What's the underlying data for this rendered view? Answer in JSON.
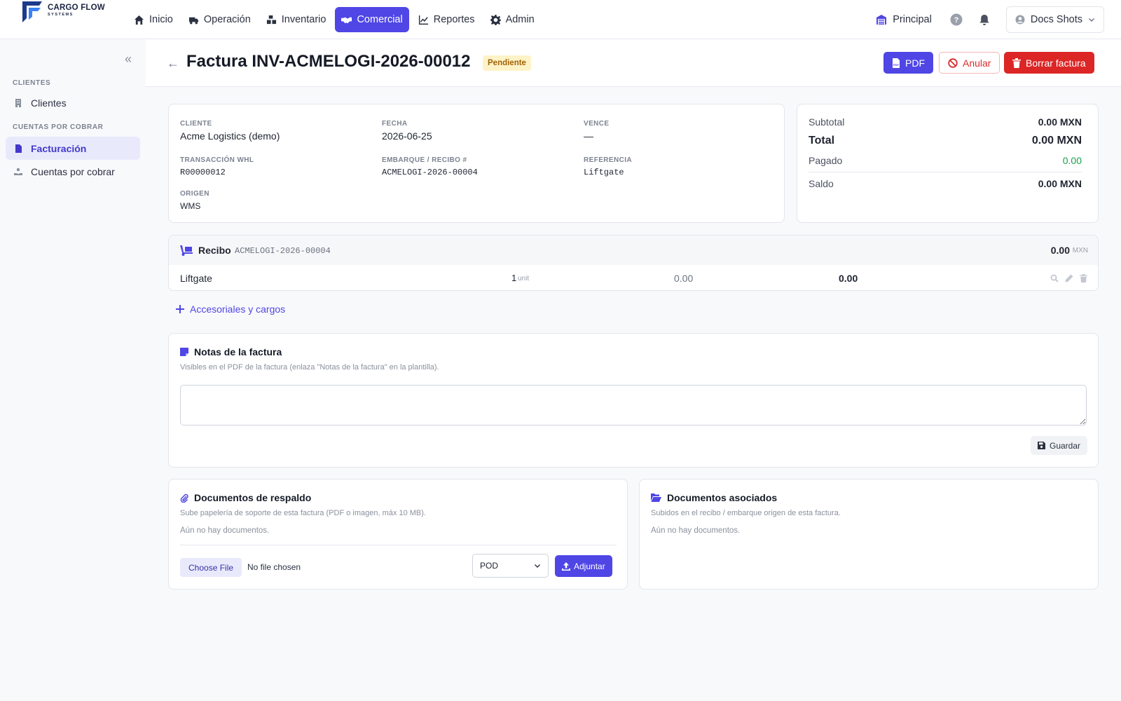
{
  "brand": {
    "name": "CARGO FLOW",
    "sub": "SYSTEMS"
  },
  "nav": [
    {
      "label": "Inicio",
      "icon": "home-icon"
    },
    {
      "label": "Operación",
      "icon": "truck-icon"
    },
    {
      "label": "Inventario",
      "icon": "boxes-icon"
    },
    {
      "label": "Comercial",
      "icon": "handshake-icon",
      "active": true
    },
    {
      "label": "Reportes",
      "icon": "chart-line-icon"
    },
    {
      "label": "Admin",
      "icon": "gear-icon"
    }
  ],
  "topright": {
    "warehouse": "Principal",
    "user": "Docs Shots"
  },
  "sidebar": {
    "sec1": "CLIENTES",
    "clientes": "Clientes",
    "sec2": "CUENTAS POR COBRAR",
    "facturacion": "Facturación",
    "cuentas": "Cuentas por cobrar"
  },
  "header": {
    "title": "Factura INV-ACMELOGI-2026-00012",
    "status": "Pendiente",
    "pdf": "PDF",
    "anular": "Anular",
    "borrar": "Borrar factura"
  },
  "info": {
    "cliente_lbl": "CLIENTE",
    "cliente": "Acme Logistics (demo)",
    "fecha_lbl": "FECHA",
    "fecha": "2026-06-25",
    "vence_lbl": "VENCE",
    "vence": "—",
    "trans_lbl": "TRANSACCIÓN WHL",
    "trans": "R00000012",
    "emb_lbl": "EMBARQUE / RECIBO #",
    "emb": "ACMELOGI-2026-00004",
    "ref_lbl": "REFERENCIA",
    "ref": "Liftgate",
    "origen_lbl": "ORIGEN",
    "origen": "WMS"
  },
  "totals": {
    "subtotal_lbl": "Subtotal",
    "subtotal": "0.00 MXN",
    "total_lbl": "Total",
    "total": "0.00 MXN",
    "pagado_lbl": "Pagado",
    "pagado": "0.00",
    "saldo_lbl": "Saldo",
    "saldo": "0.00 MXN",
    "pagado_color": "#16a34a"
  },
  "recibo": {
    "label": "Recibo",
    "code": "ACMELOGI-2026-00004",
    "amount": "0.00",
    "currency": "MXN",
    "line": {
      "desc": "Liftgate",
      "qty": "1",
      "unit": "unit",
      "price": "0.00",
      "total": "0.00"
    }
  },
  "add_charges": "Accesoriales y cargos",
  "notes": {
    "title": "Notas de la factura",
    "sub": "Visibles en el PDF de la factura (enlaza \"Notas de la factura\" en la plantilla).",
    "save": "Guardar"
  },
  "docs": {
    "title": "Documentos de respaldo",
    "sub": "Sube papelería de soporte de esta factura (PDF o imagen, máx 10 MB).",
    "empty": "Aún no hay documentos.",
    "choose": "Choose File",
    "nofile": "No file chosen",
    "type": "POD",
    "attach": "Adjuntar"
  },
  "assoc": {
    "title": "Documentos asociados",
    "sub": "Subidos en el recibo / embarque origen de esta factura.",
    "empty": "Aún no hay documentos."
  },
  "accent": "#4f46e5",
  "danger": "#dc2626"
}
